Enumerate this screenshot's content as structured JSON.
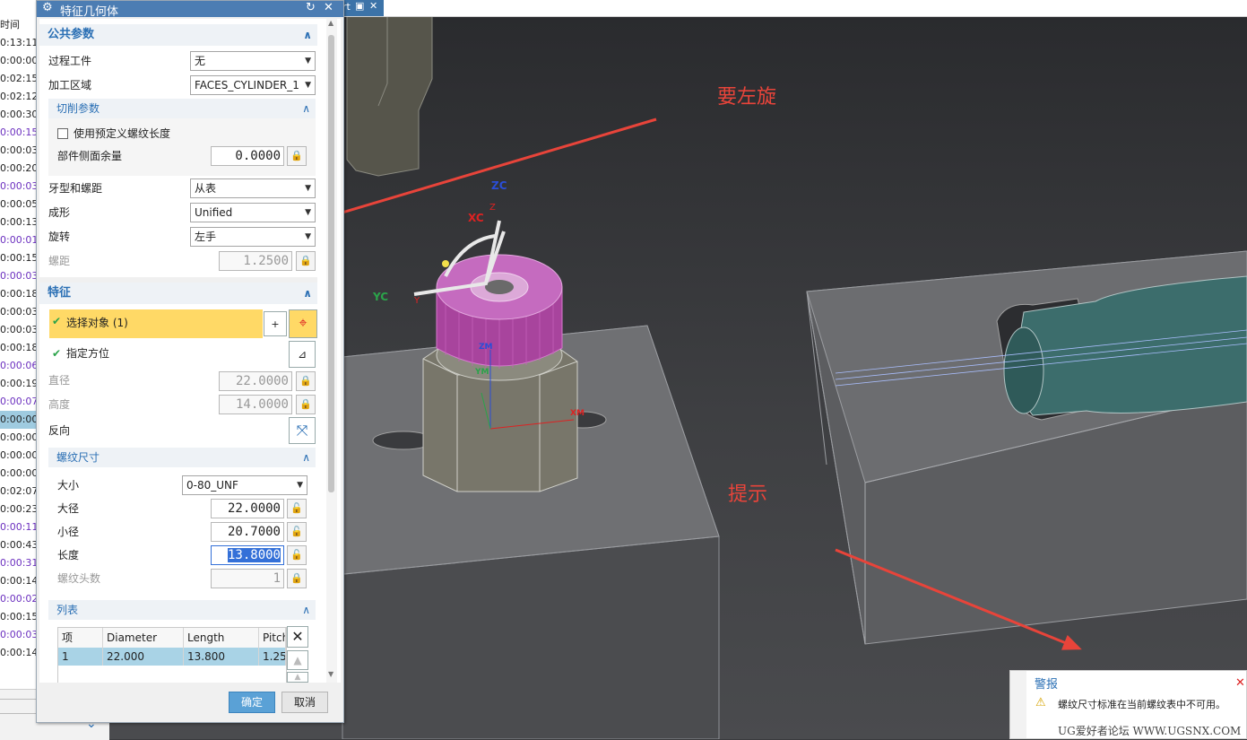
{
  "top_tab": {
    "label": "rt"
  },
  "left_list": {
    "header": "时间",
    "rows": [
      {
        "text": "0:13:11",
        "color": "normal"
      },
      {
        "text": "0:00:00",
        "color": "normal"
      },
      {
        "text": "0:02:15",
        "color": "normal"
      },
      {
        "text": "0:02:12",
        "color": "normal"
      },
      {
        "text": "0:00:30",
        "color": "normal"
      },
      {
        "text": "0:00:15",
        "color": "purple"
      },
      {
        "text": "0:00:03",
        "color": "normal"
      },
      {
        "text": "0:00:20",
        "color": "normal"
      },
      {
        "text": "0:00:03",
        "color": "purple"
      },
      {
        "text": "0:00:05",
        "color": "normal"
      },
      {
        "text": "0:00:13",
        "color": "normal"
      },
      {
        "text": "0:00:01",
        "color": "purple"
      },
      {
        "text": "0:00:15",
        "color": "normal"
      },
      {
        "text": "0:00:03",
        "color": "purple"
      },
      {
        "text": "0:00:18",
        "color": "normal"
      },
      {
        "text": "0:00:03",
        "color": "normal"
      },
      {
        "text": "0:00:03",
        "color": "normal"
      },
      {
        "text": "0:00:18",
        "color": "normal"
      },
      {
        "text": "0:00:06",
        "color": "purple"
      },
      {
        "text": "0:00:19",
        "color": "normal"
      },
      {
        "text": "0:00:07",
        "color": "purple"
      },
      {
        "text": "0:00:00",
        "color": "selected"
      },
      {
        "text": "0:00:00",
        "color": "normal"
      },
      {
        "text": "0:00:00",
        "color": "normal"
      },
      {
        "text": "0:00:00",
        "color": "normal"
      },
      {
        "text": "0:02:07",
        "color": "normal"
      },
      {
        "text": "0:00:23",
        "color": "normal"
      },
      {
        "text": "0:00:11",
        "color": "purple"
      },
      {
        "text": "0:00:43",
        "color": "normal"
      },
      {
        "text": "0:00:31",
        "color": "purple"
      },
      {
        "text": "0:00:14",
        "color": "normal"
      },
      {
        "text": "0:00:02",
        "color": "purple"
      },
      {
        "text": "0:00:15",
        "color": "normal"
      },
      {
        "text": "0:00:03",
        "color": "purple"
      },
      {
        "text": "0:00:14",
        "color": "normal"
      }
    ]
  },
  "dialog": {
    "title": "特征几何体",
    "common": {
      "header": "公共参数",
      "process_workpiece_label": "过程工件",
      "process_workpiece_value": "无",
      "machining_area_label": "加工区域",
      "machining_area_value": "FACES_CYLINDER_1",
      "cut_params": {
        "header": "切削参数",
        "use_predefined_label": "使用预定义螺纹长度",
        "part_side_stock_label": "部件侧面余量",
        "part_side_stock_value": "0.0000"
      },
      "thread_form_label": "牙型和螺距",
      "thread_form_value": "从表",
      "form_label": "成形",
      "form_value": "Unified",
      "rotation_label": "旋转",
      "rotation_value": "左手",
      "pitch_label": "螺距",
      "pitch_value": "1.2500"
    },
    "feature": {
      "header": "特征",
      "select_object_label": "选择对象 (1)",
      "specify_orientation_label": "指定方位",
      "diameter_label": "直径",
      "diameter_value": "22.0000",
      "height_label": "高度",
      "height_value": "14.0000",
      "reverse_label": "反向",
      "thread_size": {
        "header": "螺纹尺寸",
        "size_label": "大小",
        "size_value": "0-80_UNF",
        "major_label": "大径",
        "major_value": "22.0000",
        "minor_label": "小径",
        "minor_value": "20.7000",
        "length_label": "长度",
        "length_value": "13.8000",
        "starts_label": "螺纹头数",
        "starts_value": "1"
      },
      "list": {
        "header": "列表",
        "columns": [
          "项",
          "Diameter",
          "Length",
          "Pitch"
        ],
        "rows": [
          [
            "1",
            "22.000",
            "13.800",
            "1.25"
          ]
        ]
      }
    },
    "ok_label": "确定",
    "cancel_label": "取消"
  },
  "annotations": {
    "turn_left": "要左旋",
    "hint": "提示"
  },
  "axes": {
    "zc": "ZC",
    "xc": "XC",
    "yc": "YC",
    "z": "Z",
    "y": "Y",
    "zm": "ZM",
    "ym": "YM",
    "xm": "XM"
  },
  "warning": {
    "title": "警报",
    "message": "螺纹尺寸标准在当前螺纹表中不可用。"
  },
  "watermark": "UG爱好者论坛 WWW.UGSNX.COM",
  "colors": {
    "accent": "#2a6fb4",
    "annotation": "#e8443a",
    "highlight": "#ffd966"
  }
}
